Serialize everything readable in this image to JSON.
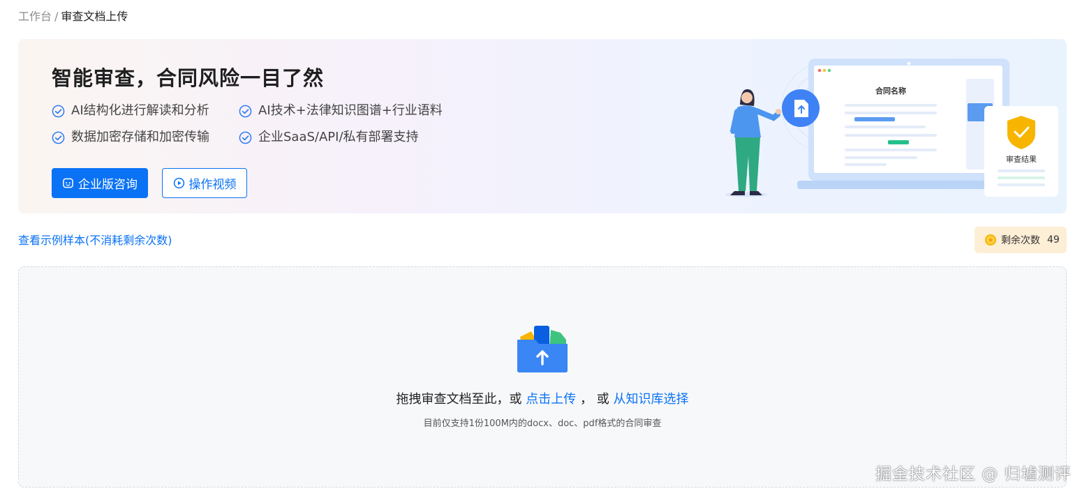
{
  "breadcrumb": {
    "parent": "工作台",
    "separator": "/",
    "current": "审查文档上传"
  },
  "banner": {
    "title": "智能审查，合同风险一目了然",
    "features": [
      "AI结构化进行解读和分析",
      "AI技术+法律知识图谱+行业语料",
      "数据加密存储和加密传输",
      "企业SaaS/API/私有部署支持"
    ],
    "primary_button": "企业版咨询",
    "secondary_button": "操作视频",
    "illustration": {
      "doc_title": "合同名称",
      "result_label": "审查结果"
    }
  },
  "sample_link": "查看示例样本(不消耗剩余次数)",
  "remaining": {
    "label": "剩余次数",
    "count": "49"
  },
  "dropzone": {
    "prefix": "拖拽审查文档至此，或",
    "upload_link": "点击上传",
    "middle": "， 或",
    "library_link": "从知识库选择",
    "hint": "目前仅支持1份100M内的docx、doc、pdf格式的合同审查"
  },
  "watermark": "掘金技术社区 @ 归墟测评",
  "colors": {
    "accent": "#0a72f5",
    "check": "#2f7cf6",
    "badge_bg": "#fdeed6",
    "shield": "#f7b500"
  }
}
